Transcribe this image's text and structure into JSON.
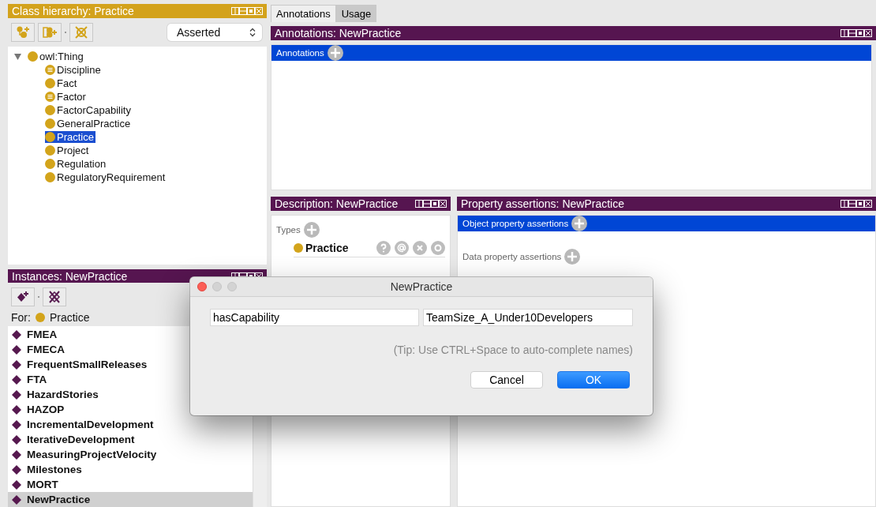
{
  "class_hierarchy": {
    "title": "Class hierarchy: Practice",
    "mode": "Asserted",
    "tree": {
      "label": "owl:Thing",
      "expanded": true,
      "selected": false,
      "kind": "class",
      "children": [
        {
          "label": "Discipline",
          "selected": false,
          "kind": "defined"
        },
        {
          "label": "Fact",
          "selected": false,
          "kind": "class"
        },
        {
          "label": "Factor",
          "selected": false,
          "kind": "defined"
        },
        {
          "label": "FactorCapability",
          "selected": false,
          "kind": "class"
        },
        {
          "label": "GeneralPractice",
          "selected": false,
          "kind": "class"
        },
        {
          "label": "Practice",
          "selected": true,
          "kind": "class"
        },
        {
          "label": "Project",
          "selected": false,
          "kind": "class"
        },
        {
          "label": "Regulation",
          "selected": false,
          "kind": "class"
        },
        {
          "label": "RegulatoryRequirement",
          "selected": false,
          "kind": "class"
        }
      ]
    }
  },
  "instances": {
    "title": "Instances: NewPractice",
    "for_label": "For:",
    "for_class": "Practice",
    "items": [
      {
        "label": "FMEA",
        "selected": false
      },
      {
        "label": "FMECA",
        "selected": false
      },
      {
        "label": "FrequentSmallReleases",
        "selected": false
      },
      {
        "label": "FTA",
        "selected": false
      },
      {
        "label": "HazardStories",
        "selected": false
      },
      {
        "label": "HAZOP",
        "selected": false
      },
      {
        "label": "IncrementalDevelopment",
        "selected": false
      },
      {
        "label": "IterativeDevelopment",
        "selected": false
      },
      {
        "label": "MeasuringProjectVelocity",
        "selected": false
      },
      {
        "label": "Milestones",
        "selected": false
      },
      {
        "label": "MORT",
        "selected": false
      },
      {
        "label": "NewPractice",
        "selected": true
      }
    ]
  },
  "tabs": [
    {
      "label": "Annotations",
      "selected": true
    },
    {
      "label": "Usage",
      "selected": false
    }
  ],
  "annotations": {
    "title": "Annotations: NewPractice",
    "section": "Annotations"
  },
  "description": {
    "title": "Description: NewPractice",
    "types_label": "Types",
    "types": [
      {
        "label": "Practice"
      }
    ]
  },
  "property_assertions": {
    "title": "Property assertions: NewPractice",
    "object_section": "Object property assertions",
    "data_section": "Data property assertions"
  },
  "dialog": {
    "title": "NewPractice",
    "property": "hasCapability",
    "value": "TeamSize_A_Under10Developers",
    "tip": "(Tip: Use CTRL+Space to auto-complete names)",
    "buttons": [
      {
        "label": "Cancel",
        "kind": "secondary"
      },
      {
        "label": "OK",
        "kind": "primary"
      }
    ]
  }
}
